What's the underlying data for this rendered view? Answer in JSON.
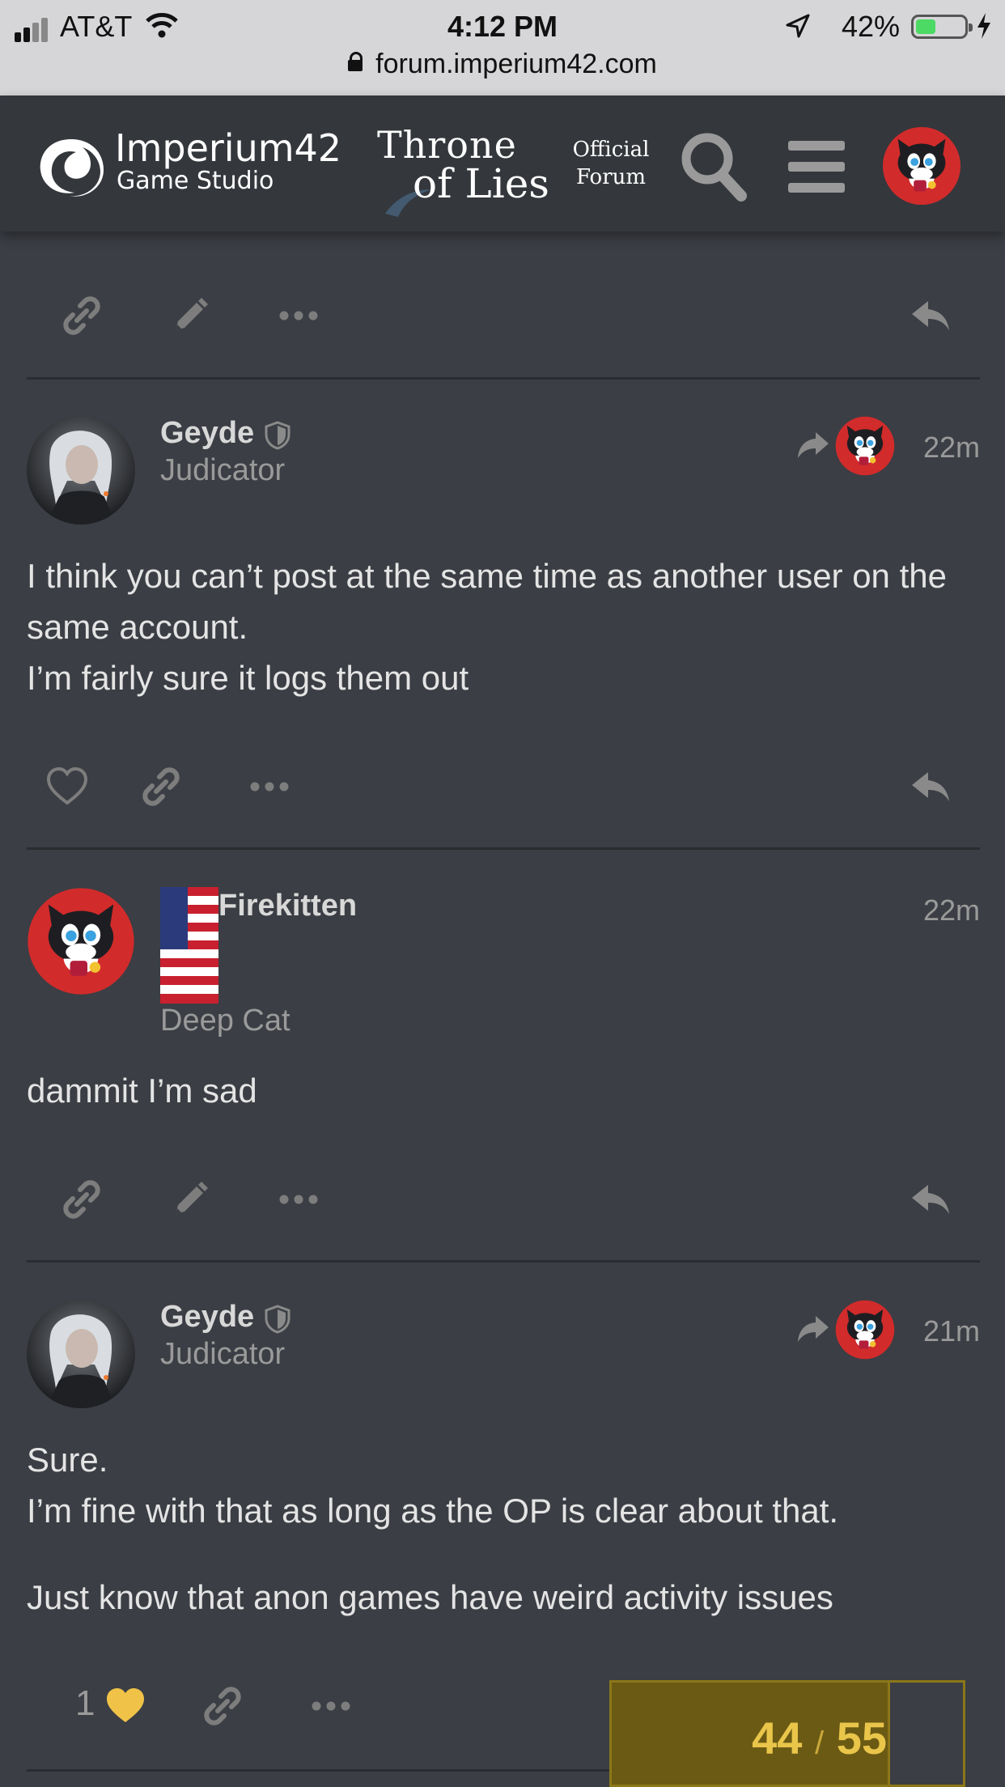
{
  "status_bar": {
    "carrier": "AT&T",
    "time": "4:12 PM",
    "battery_pct": "42%",
    "battery_level": 0.42,
    "url": "forum.imperium42.com"
  },
  "header": {
    "studio_name": "Imperium42",
    "studio_sub": "Game Studio",
    "game_line1": "Throne",
    "game_line2": "of Lies",
    "official_line1": "Official",
    "official_line2": "Forum"
  },
  "posts": [
    {
      "username": "Geyde",
      "title": "Judicator",
      "time": "22m",
      "body": [
        "I think you can’t post at the same time as another user on the same account.",
        "I’m fairly sure it logs them out"
      ]
    },
    {
      "username": "Firekitten",
      "title": "Deep Cat",
      "time": "22m",
      "body": [
        "dammit I’m sad"
      ]
    },
    {
      "username": "Geyde",
      "title": "Judicator",
      "time": "21m",
      "body": [
        "Sure.",
        "I’m fine with that as long as the OP is clear about that.",
        "Just know that anon games have weird activity issues"
      ],
      "like_count": "1"
    }
  ],
  "progress": {
    "current": "44",
    "separator": "/",
    "total": "55"
  },
  "colors": {
    "background": "#3b3e44",
    "header": "#34373c",
    "liked_heart": "#f0c348",
    "progress_bg": "#6b5a14",
    "progress_text": "#e9c54a",
    "avatar_red": "#d22b2b"
  }
}
